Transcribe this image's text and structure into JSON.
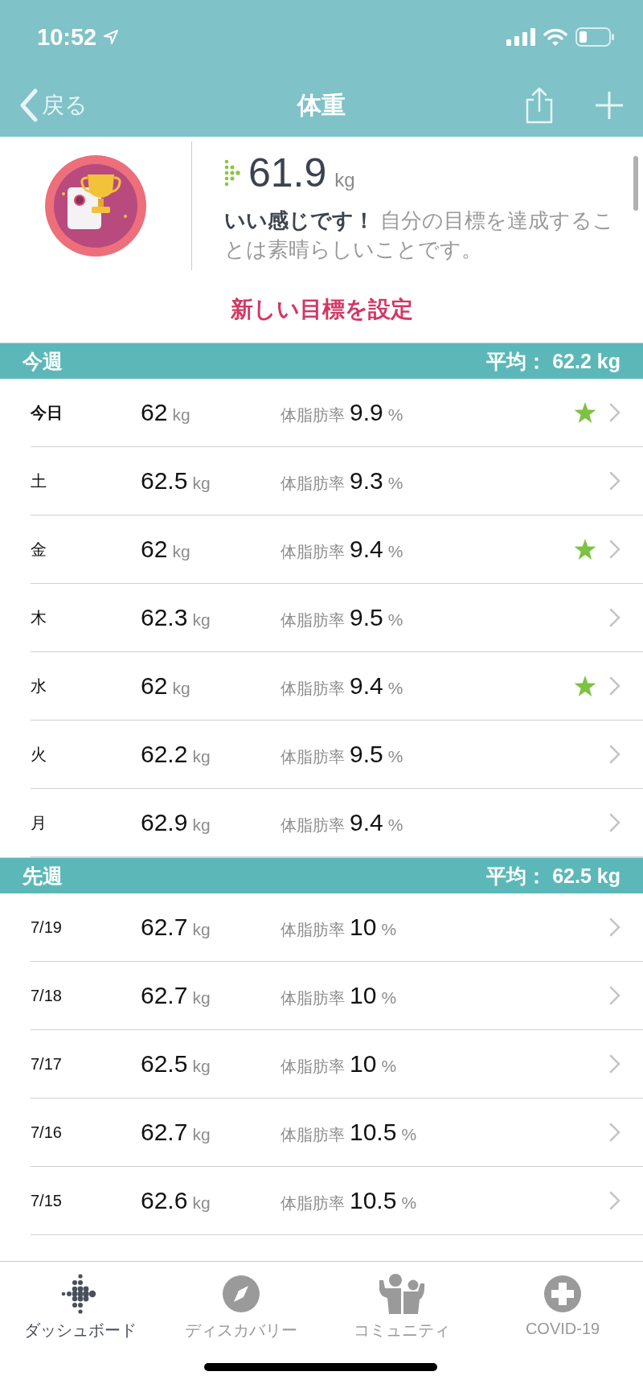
{
  "status_bar": {
    "time": "10:52"
  },
  "nav": {
    "back": "戻る",
    "title": "体重"
  },
  "goal": {
    "weight": "61.9",
    "unit": "kg",
    "message": "**いい感じです！** 自分の目標を達成することは素晴らしいことです。",
    "link": "新しい目標を設定"
  },
  "sections": [
    {
      "title": "今週",
      "average": "平均： 62.2 kg",
      "rows": [
        {
          "date": "今日",
          "current": true,
          "weight": "62",
          "unit": "kg",
          "fat_label": "体脂肪率",
          "fat": "9.9",
          "fat_unit": "%",
          "starred": true
        },
        {
          "date": "土",
          "current": false,
          "weight": "62.5",
          "unit": "kg",
          "fat_label": "体脂肪率",
          "fat": "9.3",
          "fat_unit": "%",
          "starred": false
        },
        {
          "date": "金",
          "current": false,
          "weight": "62",
          "unit": "kg",
          "fat_label": "体脂肪率",
          "fat": "9.4",
          "fat_unit": "%",
          "starred": true
        },
        {
          "date": "木",
          "current": false,
          "weight": "62.3",
          "unit": "kg",
          "fat_label": "体脂肪率",
          "fat": "9.5",
          "fat_unit": "%",
          "starred": false
        },
        {
          "date": "水",
          "current": false,
          "weight": "62",
          "unit": "kg",
          "fat_label": "体脂肪率",
          "fat": "9.4",
          "fat_unit": "%",
          "starred": true
        },
        {
          "date": "火",
          "current": false,
          "weight": "62.2",
          "unit": "kg",
          "fat_label": "体脂肪率",
          "fat": "9.5",
          "fat_unit": "%",
          "starred": false
        },
        {
          "date": "月",
          "current": false,
          "weight": "62.9",
          "unit": "kg",
          "fat_label": "体脂肪率",
          "fat": "9.4",
          "fat_unit": "%",
          "starred": false
        }
      ]
    },
    {
      "title": "先週",
      "average": "平均： 62.5 kg",
      "rows": [
        {
          "date": "7/19",
          "current": false,
          "weight": "62.7",
          "unit": "kg",
          "fat_label": "体脂肪率",
          "fat": "10",
          "fat_unit": "%",
          "starred": false
        },
        {
          "date": "7/18",
          "current": false,
          "weight": "62.7",
          "unit": "kg",
          "fat_label": "体脂肪率",
          "fat": "10",
          "fat_unit": "%",
          "starred": false
        },
        {
          "date": "7/17",
          "current": false,
          "weight": "62.5",
          "unit": "kg",
          "fat_label": "体脂肪率",
          "fat": "10",
          "fat_unit": "%",
          "starred": false
        },
        {
          "date": "7/16",
          "current": false,
          "weight": "62.7",
          "unit": "kg",
          "fat_label": "体脂肪率",
          "fat": "10.5",
          "fat_unit": "%",
          "starred": false
        },
        {
          "date": "7/15",
          "current": false,
          "weight": "62.6",
          "unit": "kg",
          "fat_label": "体脂肪率",
          "fat": "10.5",
          "fat_unit": "%",
          "starred": false
        }
      ]
    }
  ],
  "tabs": [
    {
      "label": "ダッシュボード",
      "kind": "dashboard",
      "selected": true
    },
    {
      "label": "ディスカバリー",
      "kind": "discover",
      "selected": false
    },
    {
      "label": "コミュニティ",
      "kind": "community",
      "selected": false
    },
    {
      "label": "COVID-19",
      "kind": "covid",
      "selected": false
    }
  ]
}
